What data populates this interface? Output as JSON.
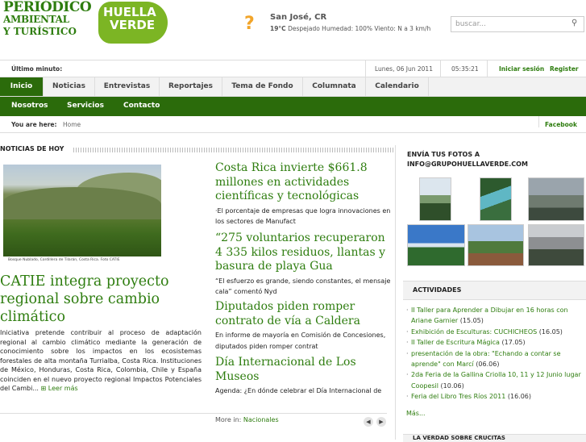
{
  "header": {
    "logo_line1": "PERIÓDICO",
    "logo_line2": "AMBIENTAL",
    "logo_line3": "Y TURÍSTICO",
    "badge_line1": "HUELLA",
    "badge_line2": "VERDE",
    "weather_icon": "question-mark-icon",
    "location": "San José, CR",
    "temperature": "19°C",
    "conditions": "Despejado  Humedad: 100%  Viento: N a 3 km/h",
    "search_placeholder": "buscar...",
    "search_icon": "magnifier-icon"
  },
  "topbar": {
    "ultimo_label": "Último minuto:",
    "date": "Lunes, 06 Jun 2011",
    "time": "05:35:21",
    "login": "Iniciar sesión",
    "register": "Register"
  },
  "nav": {
    "primary": [
      "Inicio",
      "Noticias",
      "Entrevistas",
      "Reportajes",
      "Tema de Fondo",
      "Columnata",
      "Calendario"
    ],
    "secondary": [
      "Nosotros",
      "Servicios",
      "Contacto"
    ]
  },
  "breadcrumb": {
    "label": "You are here:",
    "home": "Home",
    "facebook": "Facebook"
  },
  "news": {
    "section_title": "NOTICIAS DE HOY",
    "photo_caption": "Bosque Nublado, Cordillera de Tilarán, Costa Rica. Foto CATIE",
    "main_title": "CATIE integra proyecto regional sobre cambio climático",
    "main_body": "Iniciativa pretende contribuir al proceso de adaptación regional al cambio climático mediante la generación de conocimiento sobre los impactos en los ecosistemas forestales de alta montaña Turrialba, Costa Rica. Instituciones de México, Honduras, Costa Rica, Colombia, Chile y España coinciden en el nuevo proyecto regional Impactos Potenciales del Cambi...",
    "read_more": "Leer más",
    "articles": [
      {
        "title": "Costa Rica invierte $661.8 millones en actividades científicas y tecnológicas",
        "summary": "·El porcentaje de empresas que logra innovaciones en los sectores de Manufact"
      },
      {
        "title": "“275 voluntarios recuperaron 4 335 kilos residuos, llantas y basura de playa Gua",
        "summary": "“El esfuerzo es grande, siendo constantes, el mensaje cala” comentó Nyd"
      },
      {
        "title": "Diputados piden romper contrato de vía a Caldera",
        "summary": "En informe de mayoría en Comisión de Concesiones, diputados piden romper contrat"
      },
      {
        "title": "Día Internacional de Los Museos",
        "summary": "       Agenda: ¿En dónde celebrar el Día Internacional de"
      }
    ],
    "more_in_label": "More in:",
    "more_in_link": "Nacionales"
  },
  "sidebar": {
    "fotos_title": "ENVÍA TUS FOTOS A INFO@GRUPOHUELLAVERDE.COM",
    "actividades_title": "ACTIVIDADES",
    "activities": [
      {
        "text": "II Taller para Aprender a Dibujar en 16 horas con Ariane Garnier",
        "date": "(15.05)"
      },
      {
        "text": "Exhibición de Esculturas: CUCHICHEOS",
        "date": "(16.05)"
      },
      {
        "text": "II Taller de Escritura Mágica",
        "date": "(17.05)"
      },
      {
        "text": "presentación de la obra: \"Echando a contar se aprende\" con Marcí",
        "date": "(06.06)"
      },
      {
        "text": "2da Feria de la Gallina Criolla 10, 11 y 12 Junio lugar Coopesil",
        "date": "(10.06)"
      },
      {
        "text": "Feria del Libro Tres Ríos 2011",
        "date": "(16.06)"
      }
    ],
    "more": "Más...",
    "last_title": "LA VERDAD SOBRE CRUCITAS"
  }
}
